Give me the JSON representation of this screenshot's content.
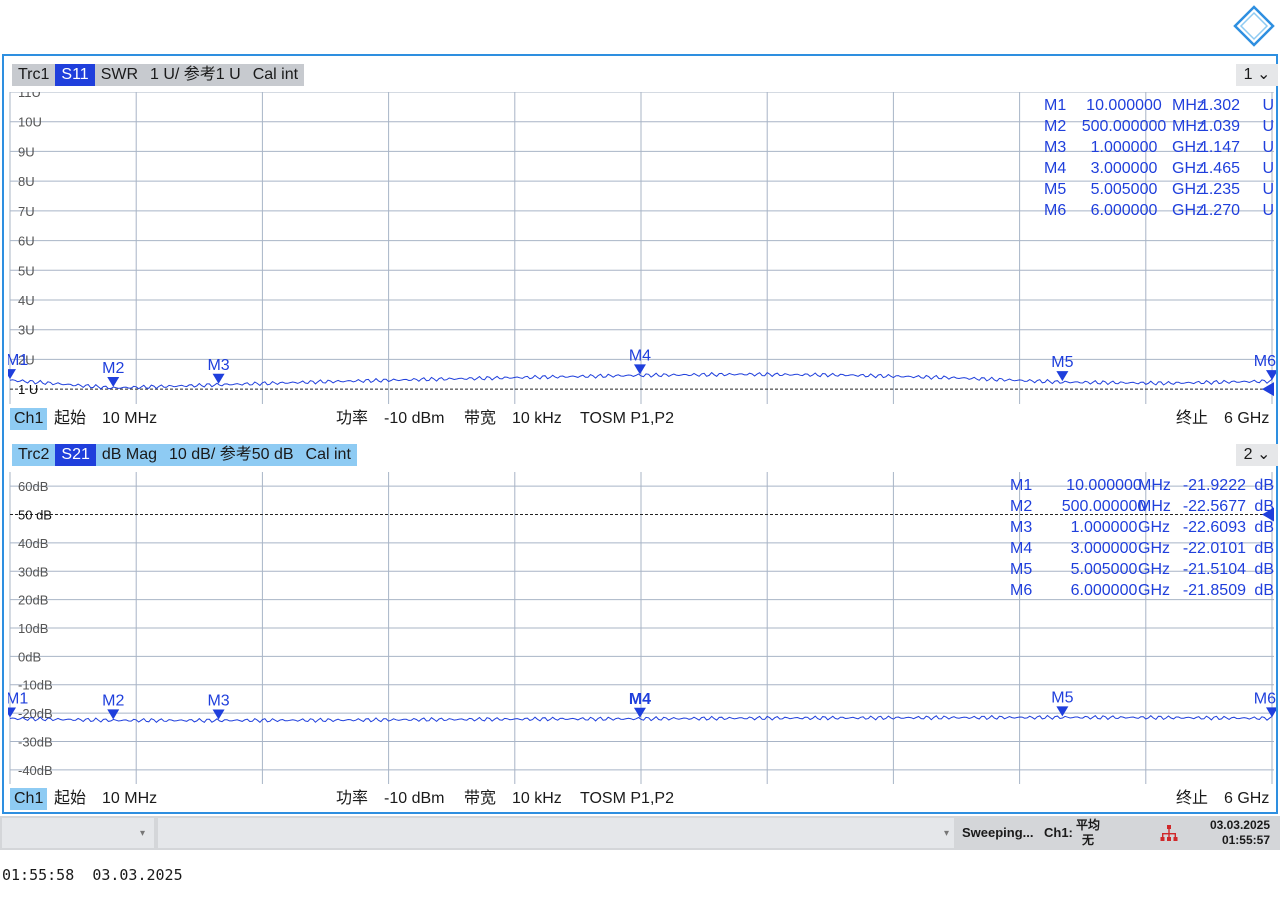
{
  "colors": {
    "trace": "#1f3fdc",
    "grid": "#a8b4c6",
    "text": "#1a1a1a",
    "accent": "#2e8fe0"
  },
  "logo": {
    "icon": "rohde-schwarz-logo"
  },
  "panel1": {
    "header": [
      "Trc1",
      "S11",
      "SWR",
      "1 U/ 参考1 U",
      "Cal int"
    ],
    "dropdown": "1",
    "ticks": [
      "11U",
      "10U",
      "9U",
      "8U",
      "7U",
      "6U",
      "5U",
      "4U",
      "3U",
      "2U"
    ],
    "ref_label": "1 U",
    "marker_readout": [
      {
        "m": "M1",
        "f": "10.000000",
        "u": "MHz",
        "v": "1.302",
        "vu": "U"
      },
      {
        "m": "M2",
        "f": "500.000000",
        "u": "MHz",
        "v": "1.039",
        "vu": "U"
      },
      {
        "m": "M3",
        "f": "1.000000",
        "u": "GHz",
        "v": "1.147",
        "vu": "U"
      },
      {
        "m": "M4",
        "f": "3.000000",
        "u": "GHz",
        "v": "1.465",
        "vu": "U"
      },
      {
        "m": "M5",
        "f": "5.005000",
        "u": "GHz",
        "v": "1.235",
        "vu": "U"
      },
      {
        "m": "M6",
        "f": "6.000000",
        "u": "GHz",
        "v": "1.270",
        "vu": "U"
      }
    ],
    "channel": {
      "ch": "Ch1",
      "start_label": "起始",
      "start": "10 MHz",
      "power_label": "功率",
      "power": "-10 dBm",
      "bw_label": "带宽",
      "bw": "10 kHz",
      "cal": "TOSM P1,P2",
      "stop_label": "终止",
      "stop": "6 GHz"
    }
  },
  "panel2": {
    "header": [
      "Trc2",
      "S21",
      "dB Mag",
      "10 dB/ 参考50 dB",
      "Cal int"
    ],
    "dropdown": "2",
    "ticks": [
      "60dB",
      "40dB",
      "30dB",
      "20dB",
      "10dB",
      "0dB",
      "-10dB",
      "-20dB",
      "-30dB",
      "-40dB"
    ],
    "ref_label": "50 dB",
    "marker_readout": [
      {
        "m": "M1",
        "f": "10.000000",
        "u": "MHz",
        "v": "-21.9222",
        "vu": "dB"
      },
      {
        "m": "M2",
        "f": "500.000000",
        "u": "MHz",
        "v": "-22.5677",
        "vu": "dB"
      },
      {
        "m": "M3",
        "f": "1.000000",
        "u": "GHz",
        "v": "-22.6093",
        "vu": "dB"
      },
      {
        "m": "M4",
        "f": "3.000000",
        "u": "GHz",
        "v": "-22.0101",
        "vu": "dB"
      },
      {
        "m": "M5",
        "f": "5.005000",
        "u": "GHz",
        "v": "-21.5104",
        "vu": "dB"
      },
      {
        "m": "M6",
        "f": "6.000000",
        "u": "GHz",
        "v": "-21.8509",
        "vu": "dB"
      }
    ],
    "channel": {
      "ch": "Ch1",
      "start_label": "起始",
      "start": "10 MHz",
      "power_label": "功率",
      "power": "-10 dBm",
      "bw_label": "带宽",
      "bw": "10 kHz",
      "cal": "TOSM P1,P2",
      "stop_label": "终止",
      "stop": "6 GHz"
    }
  },
  "status": {
    "sweep": "Sweeping...",
    "ch": "Ch1:",
    "avg_top": "平均",
    "avg_bottom": "无",
    "date": "03.03.2025",
    "time": "01:55:57",
    "net_icon": "network-icon"
  },
  "footer": {
    "time": "01:55:58",
    "date": "03.03.2025"
  },
  "chart_data": [
    {
      "type": "line",
      "trace": "S11 SWR",
      "x_unit": "GHz",
      "xlim": [
        0.01,
        6
      ],
      "ylim": [
        0.5,
        11
      ],
      "y_unit": "U",
      "grid": true,
      "reference": 1,
      "x": [
        0.01,
        0.5,
        1,
        1.5,
        2,
        2.5,
        3,
        3.5,
        4,
        4.5,
        5.005,
        5.5,
        6
      ],
      "y": [
        1.302,
        1.039,
        1.147,
        1.25,
        1.33,
        1.4,
        1.465,
        1.5,
        1.47,
        1.38,
        1.235,
        1.2,
        1.27
      ],
      "markers": [
        {
          "name": "M1",
          "x": 0.01,
          "y": 1.302
        },
        {
          "name": "M2",
          "x": 0.5,
          "y": 1.039
        },
        {
          "name": "M3",
          "x": 1,
          "y": 1.147
        },
        {
          "name": "M4",
          "x": 3,
          "y": 1.465
        },
        {
          "name": "M5",
          "x": 5.005,
          "y": 1.235
        },
        {
          "name": "M6",
          "x": 6,
          "y": 1.27
        }
      ]
    },
    {
      "type": "line",
      "trace": "S21 dB Mag",
      "x_unit": "GHz",
      "xlim": [
        0.01,
        6
      ],
      "ylim": [
        -45,
        65
      ],
      "y_unit": "dB",
      "grid": true,
      "reference": 50,
      "x": [
        0.01,
        0.5,
        1,
        1.5,
        2,
        2.5,
        3,
        3.5,
        4,
        4.5,
        5.005,
        5.5,
        6
      ],
      "y": [
        -21.9222,
        -22.5677,
        -22.6093,
        -22.5,
        -22.3,
        -22.1,
        -22.0101,
        -21.8,
        -21.7,
        -21.6,
        -21.5104,
        -21.6,
        -21.8509
      ],
      "markers": [
        {
          "name": "M1",
          "x": 0.01,
          "y": -21.9222
        },
        {
          "name": "M2",
          "x": 0.5,
          "y": -22.5677
        },
        {
          "name": "M3",
          "x": 1,
          "y": -22.6093
        },
        {
          "name": "M4",
          "x": 3,
          "y": -22.0101
        },
        {
          "name": "M5",
          "x": 5.005,
          "y": -21.5104
        },
        {
          "name": "M6",
          "x": 6,
          "y": -21.8509
        }
      ]
    }
  ]
}
